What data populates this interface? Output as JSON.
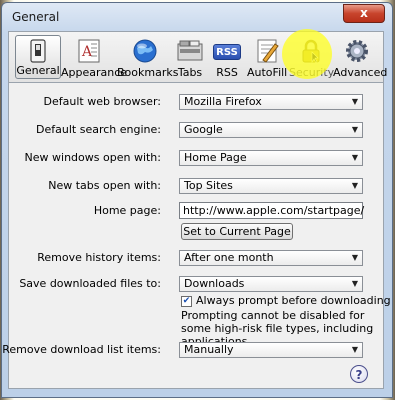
{
  "window": {
    "title": "General",
    "close_label": "x"
  },
  "toolbar": {
    "items": [
      {
        "label": "General"
      },
      {
        "label": "Appearance"
      },
      {
        "label": "Bookmarks"
      },
      {
        "label": "Tabs"
      },
      {
        "label": "RSS",
        "icon_text": "RSS"
      },
      {
        "label": "AutoFill"
      },
      {
        "label": "Security"
      },
      {
        "label": "Advanced"
      }
    ]
  },
  "settings": {
    "default_browser": {
      "label": "Default web browser:",
      "value": "Mozilla Firefox"
    },
    "search_engine": {
      "label": "Default search engine:",
      "value": "Google"
    },
    "new_windows": {
      "label": "New windows open with:",
      "value": "Home Page"
    },
    "new_tabs": {
      "label": "New tabs open with:",
      "value": "Top Sites"
    },
    "home_page": {
      "label": "Home page:",
      "value": "http://www.apple.com/startpage/",
      "button": "Set to Current Page"
    },
    "history": {
      "label": "Remove history items:",
      "value": "After one month"
    },
    "downloads": {
      "label": "Save downloaded files to:",
      "value": "Downloads"
    },
    "always_prompt": {
      "label": "Always prompt before downloading",
      "checked": true,
      "note": "Prompting cannot be disabled for some high-risk file types, including applications."
    },
    "download_list": {
      "label": "Remove download list items:",
      "value": "Manually"
    }
  },
  "help": {
    "label": "?"
  },
  "colors": {
    "highlight": "#ffff1e",
    "window_frame": "#bcd0e8",
    "panel": "#f0f0f0"
  }
}
